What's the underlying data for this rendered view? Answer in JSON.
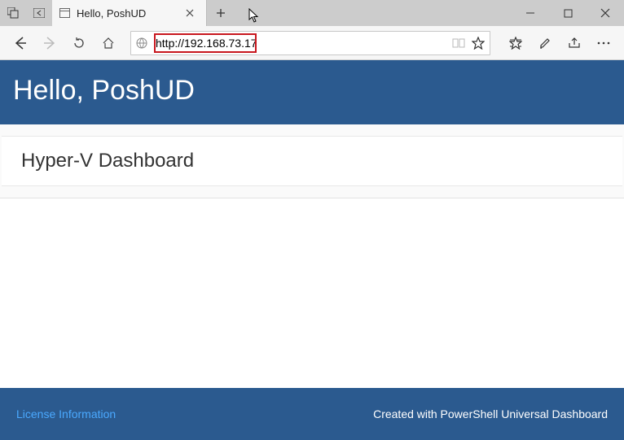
{
  "browser": {
    "tab_title": "Hello, PoshUD",
    "url": "http://192.168.73.17"
  },
  "header": {
    "title": "Hello, PoshUD"
  },
  "card": {
    "heading": "Hyper-V Dashboard"
  },
  "footer": {
    "license_link": "License Information",
    "credit": "Created with PowerShell Universal Dashboard"
  }
}
